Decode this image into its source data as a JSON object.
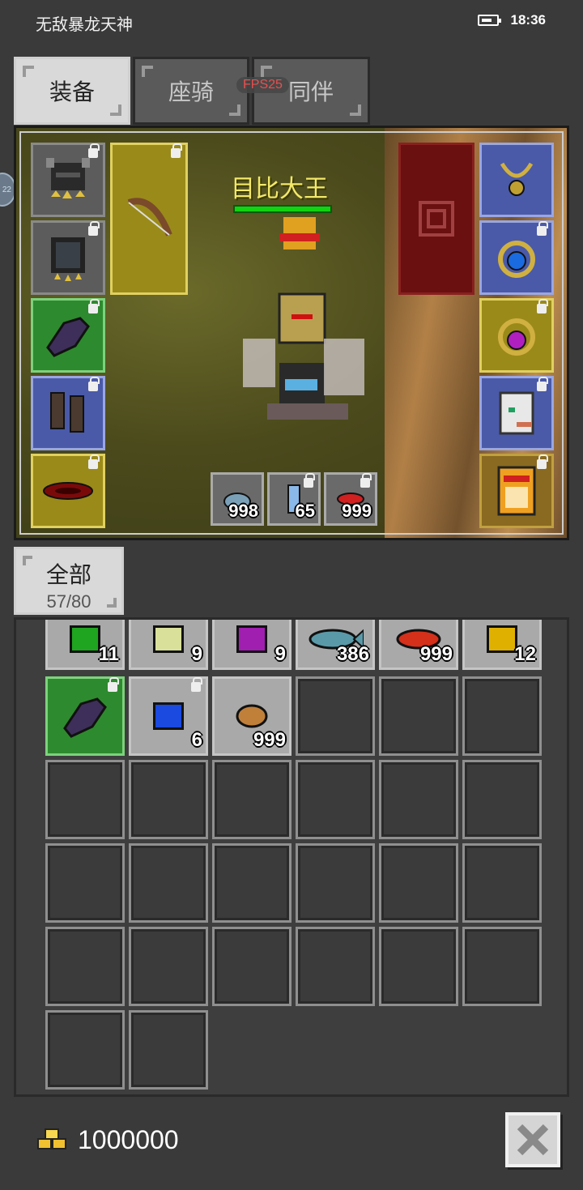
{
  "status_bar": {
    "title": "无敌暴龙天神",
    "time": "18:36"
  },
  "tabs": [
    {
      "label": "装备",
      "active": true
    },
    {
      "label": "座骑",
      "active": false
    },
    {
      "label": "同伴",
      "active": false
    }
  ],
  "fps": "FPS25",
  "side_bubble": "22",
  "hero": {
    "name": "目比大王",
    "hp_fraction": 1.0
  },
  "consumables": [
    {
      "icon": "potion-flask-icon",
      "count": "998"
    },
    {
      "icon": "scroll-bottle-icon",
      "count": "65"
    },
    {
      "icon": "red-fish-icon",
      "count": "999"
    }
  ],
  "filter": {
    "label": "全部",
    "count": "57/80"
  },
  "inventory_rows": [
    [
      {
        "icon": "green-gem-icon",
        "count": "11",
        "color": "#1fa51f"
      },
      {
        "icon": "pale-gem-icon",
        "count": "9",
        "color": "#d8e09a"
      },
      {
        "icon": "purple-gem-icon",
        "count": "9",
        "color": "#a01fb0"
      },
      {
        "icon": "fish-icon",
        "count": "386",
        "color": "#5a9aa8"
      },
      {
        "icon": "red-meat-icon",
        "count": "999",
        "color": "#d4301a"
      },
      {
        "icon": "yellow-gem-icon",
        "count": "12",
        "color": "#e0b000"
      }
    ],
    [
      {
        "icon": "purple-glove-icon",
        "count": "",
        "locked": true
      },
      {
        "icon": "blue-gem-icon",
        "count": "6",
        "color": "#1a4ae0",
        "locked": true
      },
      {
        "icon": "bread-icon",
        "count": "999",
        "color": "#c0803a"
      }
    ]
  ],
  "gold": "1000000"
}
